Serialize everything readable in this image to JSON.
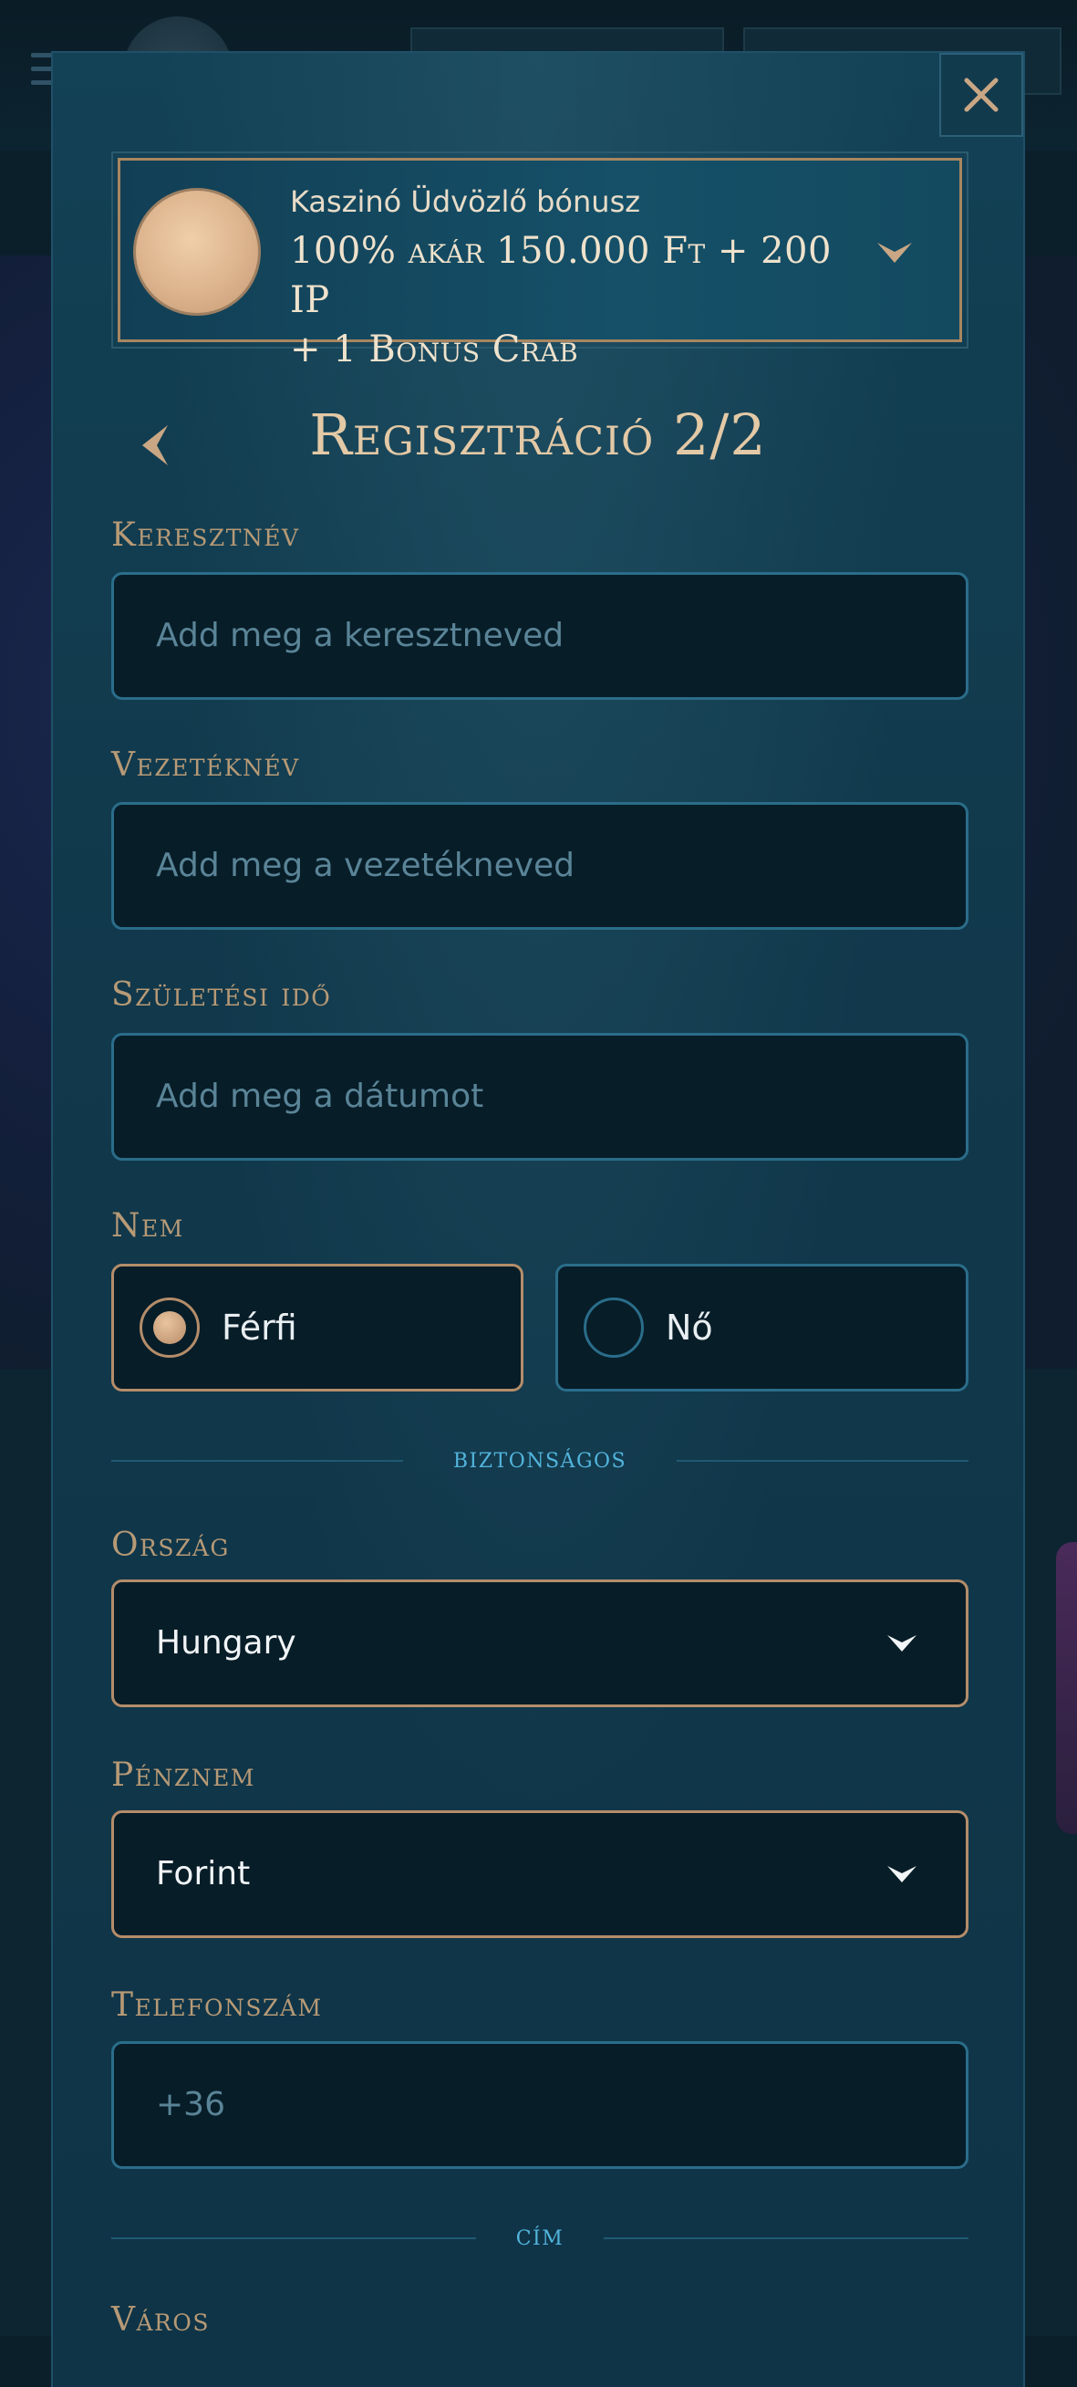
{
  "bonus": {
    "title": "Kaszinó Üdvözlő bónusz",
    "offer_line1": "100% akár 150.000 Ft + 200 IP",
    "offer_line2": "+ 1 Bonus Crab"
  },
  "page": {
    "title": "Regisztráció 2/2"
  },
  "form": {
    "first_name": {
      "label": "Keresztnév",
      "placeholder": "Add meg a keresztneved"
    },
    "last_name": {
      "label": "Vezetéknév",
      "placeholder": "Add meg a vezetékneved"
    },
    "birth_date": {
      "label": "Születési idő",
      "placeholder": "Add meg a dátumot"
    },
    "gender": {
      "label": "Nem",
      "options": [
        {
          "label": "Férfi",
          "selected": true
        },
        {
          "label": "Nő",
          "selected": false
        }
      ]
    },
    "section_secure": "biztonságos",
    "country": {
      "label": "Ország",
      "value": "Hungary"
    },
    "currency": {
      "label": "Pénznem",
      "value": "Forint"
    },
    "phone": {
      "label": "Telefonszám",
      "placeholder": "+36"
    },
    "section_address": "cím",
    "city": {
      "label": "Város"
    }
  },
  "icons": {
    "close": "close-icon",
    "back": "chevron-left-icon",
    "expand": "chevron-down-icon"
  },
  "colors": {
    "gold": "#b48d6a",
    "title_gold": "#e3c9a6",
    "teal_accent": "#52b4dc",
    "field_bg": "#071d28",
    "modal_bg": "#11384b"
  }
}
